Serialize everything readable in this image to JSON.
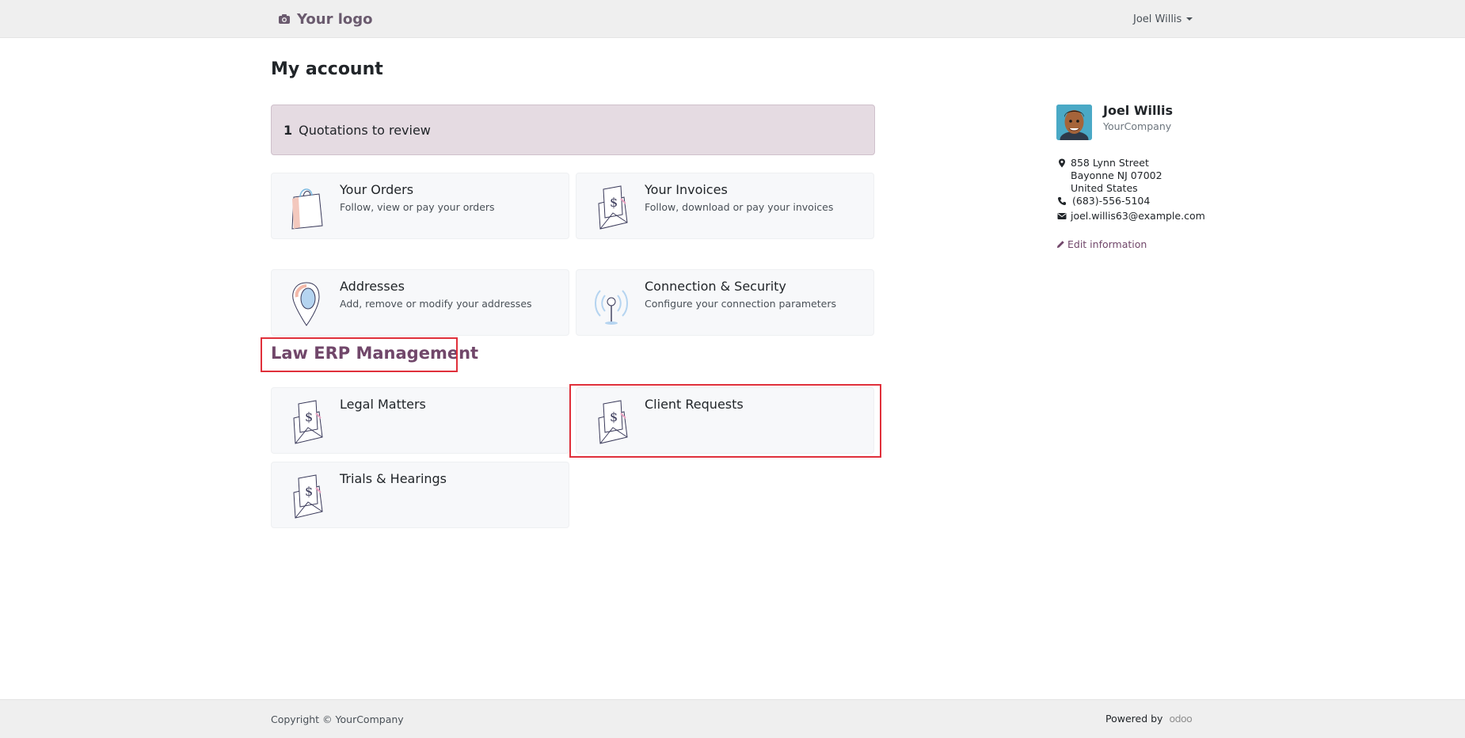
{
  "header": {
    "logo_text": "Your logo",
    "user_name": "Joel Willis"
  },
  "page": {
    "title": "My account"
  },
  "alert": {
    "count": "1",
    "label": "Quotations to review"
  },
  "cards": [
    {
      "title": "Your Orders",
      "description": "Follow, view or pay your orders"
    },
    {
      "title": "Your Invoices",
      "description": "Follow, download or pay your invoices"
    },
    {
      "title": "Addresses",
      "description": "Add, remove or modify your addresses"
    },
    {
      "title": "Connection & Security",
      "description": "Configure your connection parameters"
    }
  ],
  "law_section": {
    "title": "Law ERP Management",
    "cards": [
      {
        "title": "Legal Matters"
      },
      {
        "title": "Client Requests"
      },
      {
        "title": "Trials & Hearings"
      }
    ]
  },
  "sidebar": {
    "name": "Joel Willis",
    "company": "YourCompany",
    "address_lines": [
      "858 Lynn Street",
      "Bayonne NJ 07002",
      "United States"
    ],
    "phone": "(683)-556-5104",
    "email": "joel.willis63@example.com",
    "edit_label": "Edit information"
  },
  "footer": {
    "copyright": "Copyright © YourCompany",
    "powered_by": "Powered by",
    "brand": "odoo"
  },
  "colors": {
    "accent": "#71476a",
    "highlight": "#e0303b",
    "alert_bg": "#e5dbe2"
  }
}
